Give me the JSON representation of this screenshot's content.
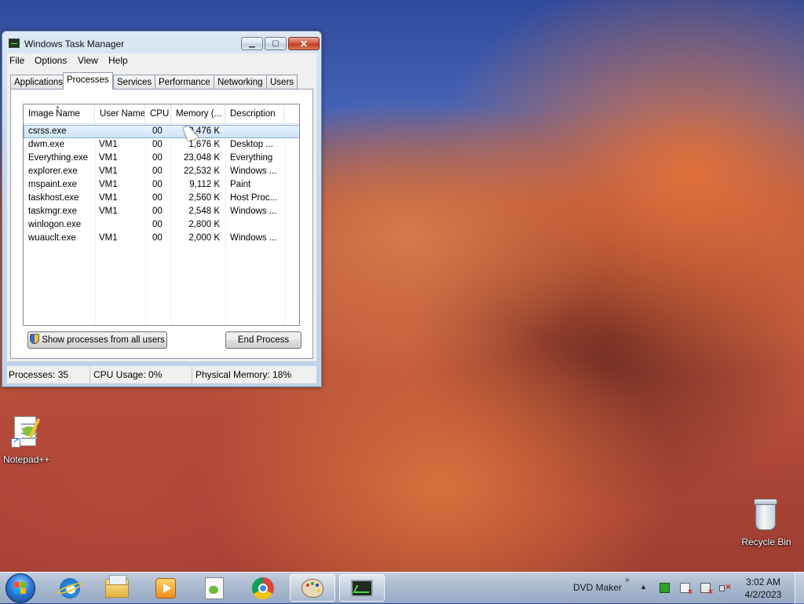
{
  "window": {
    "title": "Windows Task Manager",
    "menu": [
      "File",
      "Options",
      "View",
      "Help"
    ],
    "tabs": [
      "Applications",
      "Processes",
      "Services",
      "Performance",
      "Networking",
      "Users"
    ],
    "active_tab": "Processes",
    "columns": [
      "Image Name",
      "User Name",
      "CPU",
      "Memory (...",
      "Description"
    ],
    "processes": [
      {
        "name": "csrss.exe",
        "user": "",
        "cpu": "00",
        "memory": "2,476 K",
        "description": "",
        "selected": true
      },
      {
        "name": "dwm.exe",
        "user": "VM1",
        "cpu": "00",
        "memory": "1,676 K",
        "description": "Desktop ..."
      },
      {
        "name": "Everything.exe",
        "user": "VM1",
        "cpu": "00",
        "memory": "23,048 K",
        "description": "Everything"
      },
      {
        "name": "explorer.exe",
        "user": "VM1",
        "cpu": "00",
        "memory": "22,532 K",
        "description": "Windows ..."
      },
      {
        "name": "mspaint.exe",
        "user": "VM1",
        "cpu": "00",
        "memory": "9,112 K",
        "description": "Paint"
      },
      {
        "name": "taskhost.exe",
        "user": "VM1",
        "cpu": "00",
        "memory": "2,560 K",
        "description": "Host Proc..."
      },
      {
        "name": "taskmgr.exe",
        "user": "VM1",
        "cpu": "00",
        "memory": "2,548 K",
        "description": "Windows ..."
      },
      {
        "name": "winlogon.exe",
        "user": "",
        "cpu": "00",
        "memory": "2,800 K",
        "description": ""
      },
      {
        "name": "wuauclt.exe",
        "user": "VM1",
        "cpu": "00",
        "memory": "2,000 K",
        "description": "Windows ..."
      }
    ],
    "show_all_label": "Show processes from all users",
    "end_process_label": "End Process",
    "status": {
      "processes": "Processes: 35",
      "cpu": "CPU Usage: 0%",
      "memory": "Physical Memory: 18%"
    }
  },
  "desktop": {
    "notepad_label": "Notepad++",
    "recycle_label": "Recycle Bin"
  },
  "taskbar": {
    "toolbar_label": "DVD Maker",
    "time": "3:02 AM",
    "date": "4/2/2023",
    "pinned": [
      "internet-explorer",
      "windows-explorer",
      "windows-media-player",
      "notepad-plus-plus",
      "google-chrome",
      "paint",
      "task-manager"
    ]
  }
}
